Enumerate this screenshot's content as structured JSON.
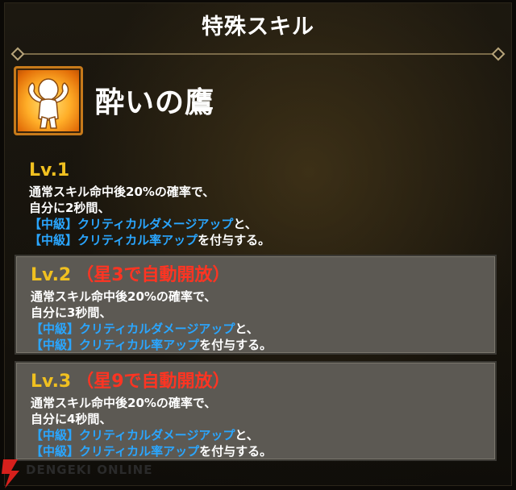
{
  "header": {
    "title": "特殊スキル"
  },
  "skill": {
    "name": "酔いの鷹",
    "icon": "flexing-character-icon"
  },
  "levels": [
    {
      "level": "Lv.1",
      "unlock": "",
      "line1": "通常スキル命中後20%の確率で、",
      "line2": "自分に2秒間、",
      "buff1": "【中級】クリティカルダメージアップ",
      "buff1_suffix": "と、",
      "buff2": "【中級】クリティカル率アップ",
      "buff2_suffix": "を付与する。"
    },
    {
      "level": "Lv.2",
      "unlock": "（星3で自動開放）",
      "line1": "通常スキル命中後20%の確率で、",
      "line2": "自分に3秒間、",
      "buff1": "【中級】クリティカルダメージアップ",
      "buff1_suffix": "と、",
      "buff2": "【中級】クリティカル率アップ",
      "buff2_suffix": "を付与する。"
    },
    {
      "level": "Lv.3",
      "unlock": "（星9で自動開放）",
      "line1": "通常スキル命中後20%の確率で、",
      "line2": "自分に4秒間、",
      "buff1": "【中級】クリティカルダメージアップ",
      "buff1_suffix": "と、",
      "buff2": "【中級】クリティカル率アップ",
      "buff2_suffix": "を付与する。"
    }
  ],
  "colors": {
    "level_label": "#f0c020",
    "unlock_label": "#ff3422",
    "buff_text": "#2aa6ff",
    "locked_box": "#5c5953"
  },
  "watermark": {
    "text": "DENGEKI ONLINE",
    "icon": "lightning-logo-icon"
  }
}
